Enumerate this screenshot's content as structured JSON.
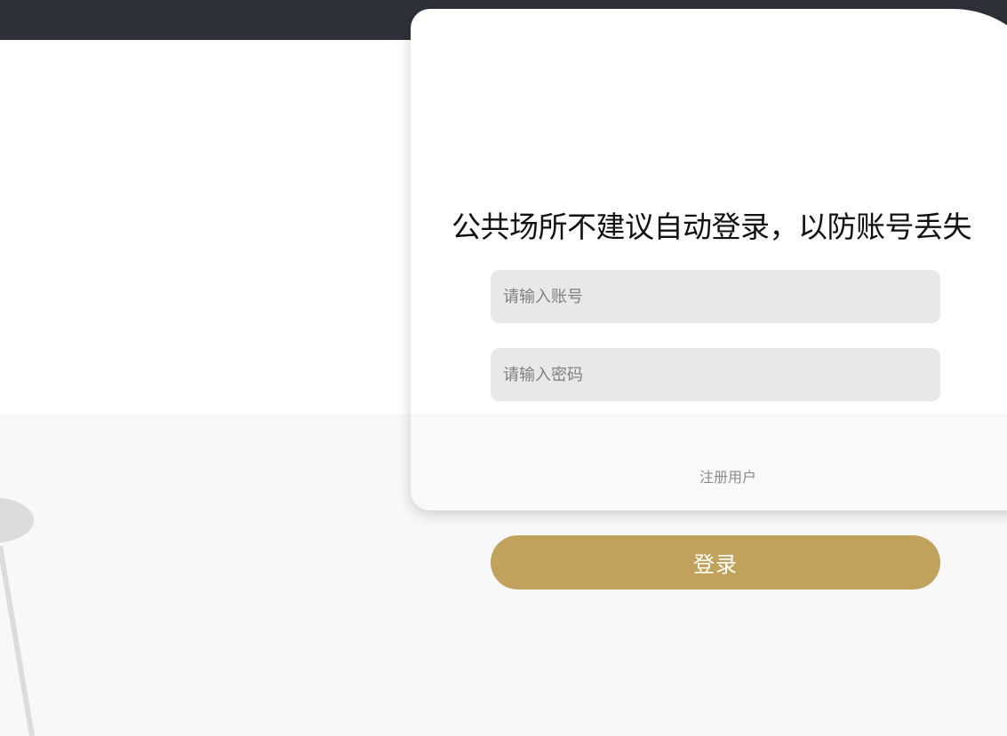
{
  "colors": {
    "top_bar": "#2e313a",
    "accent_button": "#c0a25c",
    "input_background": "#e8e8e8",
    "lower_background": "#f8f8f8"
  },
  "login": {
    "notice": "公共场所不建议自动登录，以防账号丢失",
    "account_placeholder": "请输入账号",
    "password_placeholder": "请输入密码",
    "register_link": "注册用户",
    "login_button": "登录"
  }
}
